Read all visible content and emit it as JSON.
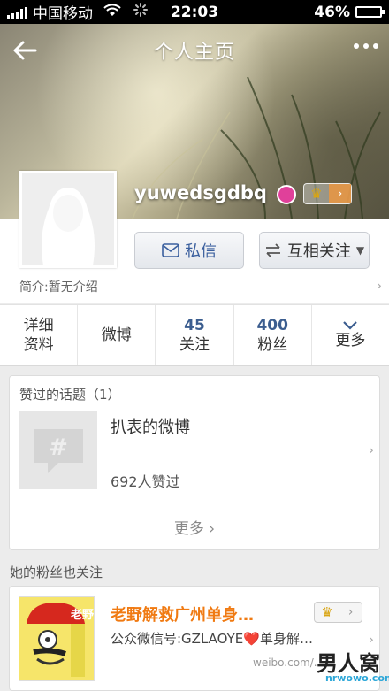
{
  "status_bar": {
    "carrier": "中国移动",
    "time": "22:03",
    "battery": "46%",
    "battery_level": 0.46
  },
  "nav": {
    "title": "个人主页",
    "back_icon": "back-arrow-icon",
    "more_icon": "more-dots-icon"
  },
  "profile": {
    "username": "yuwedsgdbq",
    "message_button": "私信",
    "follow_button": "互相关注",
    "intro": "简介:暂无介绍"
  },
  "stats": [
    {
      "top": "详细",
      "bottom": "资料"
    },
    {
      "top": "",
      "bottom": "微博"
    },
    {
      "top": "45",
      "bottom": "关注"
    },
    {
      "top": "400",
      "bottom": "粉丝"
    },
    {
      "top": "",
      "bottom": "更多"
    }
  ],
  "topics": {
    "title": "赞过的话题（1）",
    "name": "扒表的微博",
    "likes": "692人赞过",
    "more": "更多"
  },
  "fans_section": {
    "title": "她的粉丝也关注",
    "user_name": "老野解救广州单身…",
    "user_desc": "公众微信号:GZLAOYE❤️单身解…",
    "avatar_text": "老野"
  },
  "watermark": {
    "weibo": "weibo.com/...",
    "logo": "男人窝",
    "site": "nrwowo.com"
  }
}
